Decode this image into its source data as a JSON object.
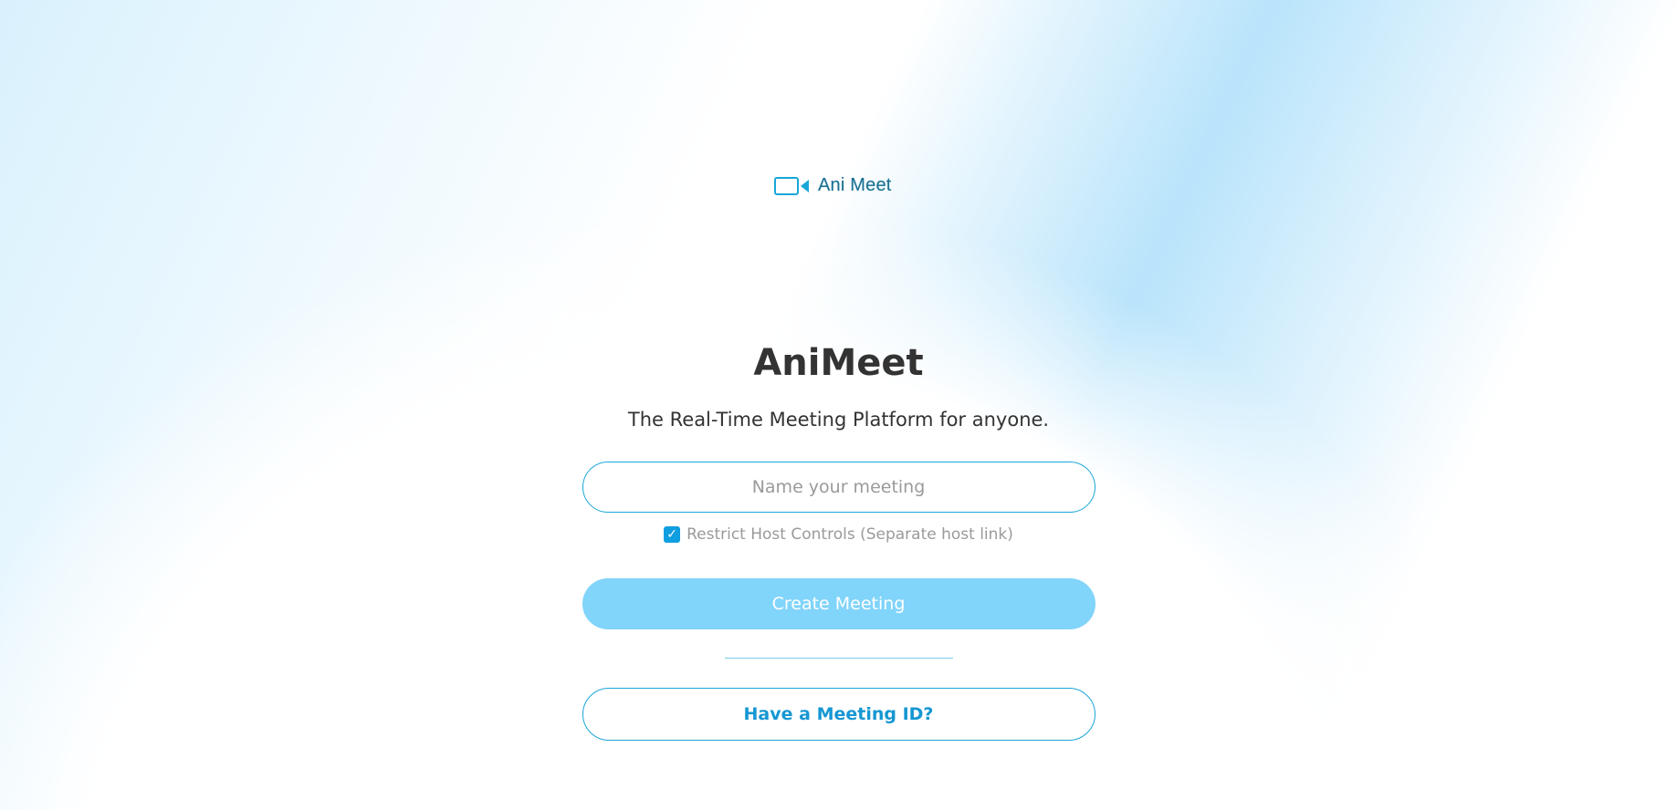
{
  "brand": {
    "icon": "video-camera-icon",
    "name": "Ani Meet"
  },
  "hero": {
    "title": "AniMeet",
    "subtitle": "The Real-Time Meeting Platform for anyone."
  },
  "form": {
    "meeting_name": {
      "value": "",
      "placeholder": "Name your meeting"
    },
    "restrict_host": {
      "checked": true,
      "label": "Restrict Host Controls (Separate host link)"
    },
    "create_label": "Create Meeting",
    "join_label": "Have a Meeting ID?"
  },
  "colors": {
    "accent": "#19a6d8",
    "create_button_bg": "#81d4fa",
    "checkbox": "#0f9ee0",
    "join_text": "#1597d3",
    "title_text": "#333333",
    "muted_text": "#9a9a9a"
  }
}
